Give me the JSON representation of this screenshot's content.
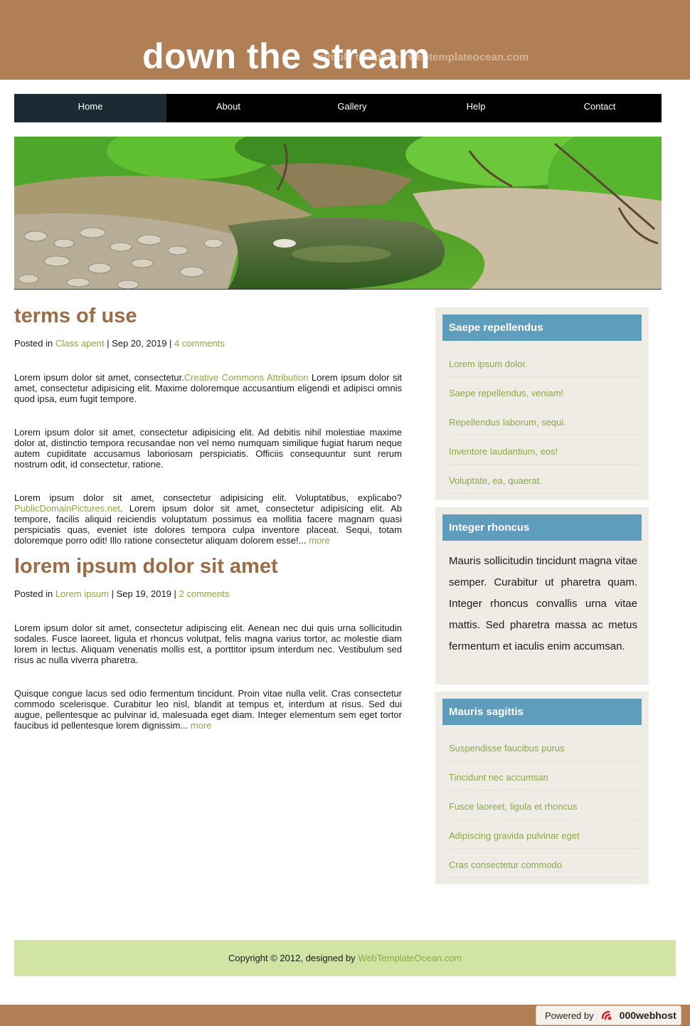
{
  "header": {
    "title": "down the stream",
    "tagline": "simple template  |  webtemplateocean.com"
  },
  "nav": {
    "items": [
      {
        "label": "Home"
      },
      {
        "label": "About"
      },
      {
        "label": "Gallery"
      },
      {
        "label": "Help"
      },
      {
        "label": "Contact"
      }
    ]
  },
  "posts": [
    {
      "title": "terms of use",
      "meta_prefix": "Posted in ",
      "category": "Class apent",
      "date": " | Sep 20, 2019 | ",
      "comments": "4 comments",
      "p1_a": "Lorem ipsum dolor sit amet, consectetur.",
      "p1_link": "Creative Commons Attribution",
      "p1_b": " Lorem ipsum dolor sit amet, consectetur adipisicing elit. Maxime doloremque accusantium eligendi et adipisci omnis quod ipsa, eum fugit tempore.",
      "p2": "Lorem ipsum dolor sit amet, consectetur adipisicing elit. Ad debitis nihil molestiae maxime dolor at, distinctio tempora recusandae non vel nemo numquam similique fugiat harum neque autem cupiditate accusamus laboriosam perspiciatis. Officiis consequuntur sunt rerum nostrum odit, id consectetur, ratione.",
      "p3_a": "Lorem ipsum dolor sit amet, consectetur adipisicing elit. Voluptatibus, explicabo? ",
      "p3_link": "PublicDomainPictures.net",
      "p3_b": ". Lorem ipsum dolor sit amet, consectetur adipisicing elit. Ab tempore, facilis aliquid reiciendis voluptatum possimus ea mollitia facere magnam quasi perspiciatis quas, eveniet iste dolores tempora culpa inventore placeat. Sequi, totam doloremque porro odit! Illo ratione consectetur aliquam dolorem esse!... ",
      "more": "more"
    },
    {
      "title": "lorem ipsum dolor sit amet",
      "meta_prefix": "Posted in ",
      "category": "Lorem ipsum",
      "date": " | Sep 19, 2019 | ",
      "comments": "2 comments",
      "p1": "Lorem ipsum dolor sit amet, consectetur adipiscing elit. Aenean nec dui quis urna sollicitudin sodales. Fusce laoreet, ligula et rhoncus volutpat, felis magna varius tortor, ac molestie diam lorem in lectus. Aliquam venenatis mollis est, a porttitor ipsum interdum nec. Vestibulum sed risus ac nulla viverra pharetra.",
      "p2": "Quisque congue lacus sed odio fermentum tincidunt. Proin vitae nulla velit. Cras consectetur commodo scelerisque. Curabitur leo nisl, blandit at tempus et, interdum at risus. Sed dui augue, pellentesque ac pulvinar id, malesuada eget diam. Integer elementum sem eget tortor faucibus id pellentesque lorem dignissim... ",
      "more": "more"
    }
  ],
  "sidebar": {
    "box1": {
      "title": "Saepe repellendus",
      "items": [
        "Lorem ipsum dolor.",
        "Saepe repellendus, veniam!",
        "Repellendus laborum, sequi.",
        "Inventore laudantium, eos!",
        "Voluptate, ea, quaerat."
      ]
    },
    "box2": {
      "title": "Integer rhoncus",
      "text": "Mauris sollicitudin tincidunt magna vitae semper. Curabitur ut pharetra quam. Integer rhoncus convallis urna vitae mattis. Sed pharetra massa ac metus fermentum et iaculis enim accumsan."
    },
    "box3": {
      "title": "Mauris sagittis",
      "items": [
        "Suspendisse faucibus purus",
        "Tincidunt nec accumsan",
        "Fusce laoreet, ligula et rhoncus",
        "Adipiscing gravida pulvinar eget",
        "Cras consectetur commodo"
      ]
    }
  },
  "footer": {
    "copyright": "Copyright © 2012, designed by ",
    "link": "WebTemplateOcean.com"
  },
  "powered": {
    "prefix": "Powered by",
    "brand": "000webhost"
  },
  "colors": {
    "header_bg": "#b07f55",
    "title_brown": "#9b6c47",
    "link_green": "#8aa844",
    "sidebar_blue": "#5f9dbc",
    "footer_green": "#d1e4a4"
  }
}
